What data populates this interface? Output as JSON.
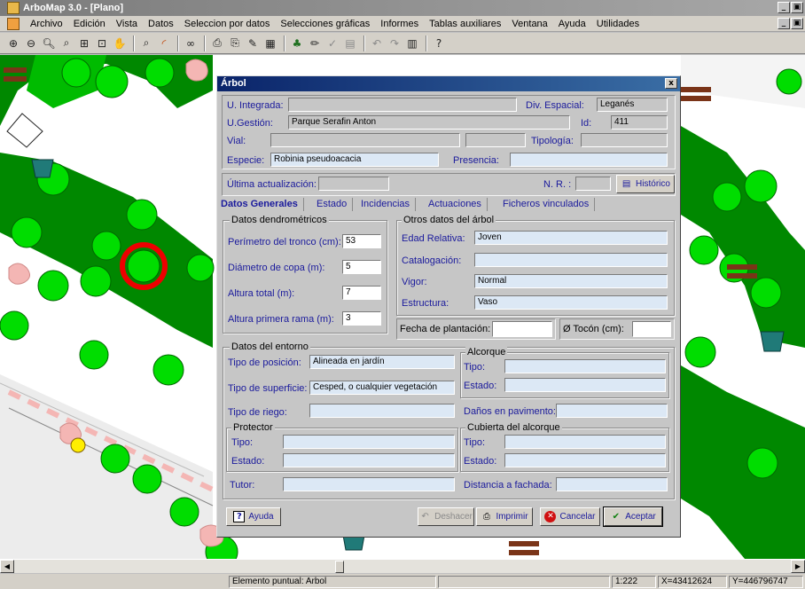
{
  "window": {
    "title": "ArboMap 3.0 - [Plano]",
    "controls": [
      "_",
      "ő",
      "x"
    ]
  },
  "menu": {
    "items": [
      "Archivo",
      "Edición",
      "Vista",
      "Datos",
      "Seleccion por datos",
      "Selecciones gráficas",
      "Informes",
      "Tablas auxiliares",
      "Ventana",
      "Ayuda",
      "Utilidades"
    ]
  },
  "toolbar": {
    "icons": [
      "zoom-in-icon",
      "zoom-out-icon",
      "zoom-previous-icon",
      "zoom-window-icon",
      "zoom-extents-icon",
      "zoom-all-icon",
      "pan-hand-icon",
      "zoom-select-icon",
      "color-rainbow-icon",
      "binoculars-icon",
      "print-icon",
      "print-preview-icon",
      "paint-icon",
      "table-icon",
      "tree-data-icon",
      "pencil-icon",
      "check-icon",
      "chart-icon",
      "undo-icon",
      "redo-icon",
      "map-icon",
      "help-icon"
    ]
  },
  "dialog": {
    "title": "Árbol",
    "close": "x",
    "u_integrada": {
      "label": "U. Integrada:",
      "value": ""
    },
    "div_espacial": {
      "label": "Div. Espacial:",
      "value": "Leganés"
    },
    "u_gestion": {
      "label": "U.Gestión:",
      "value": "Parque Serafin Anton"
    },
    "id": {
      "label": "Id:",
      "value": "411"
    },
    "vial": {
      "label": "Vial:",
      "value": ""
    },
    "tipologia": {
      "label": "Tipología:",
      "value": ""
    },
    "especie": {
      "label": "Especie:",
      "value": "Robinia pseudoacacia"
    },
    "presencia": {
      "label": "Presencia:",
      "value": ""
    },
    "ultima_actualizacion": {
      "label": "Última actualización:",
      "value": ""
    },
    "nr": {
      "label": "N. R. :",
      "value": ""
    },
    "historico_button": "Histórico",
    "tabs": [
      "Datos Generales",
      "Estado",
      "Incidencias",
      "Actuaciones",
      "Ficheros vinculados"
    ],
    "dendro": {
      "legend": "Datos dendrométricos",
      "perimetro": {
        "label": "Perímetro del tronco (cm):",
        "value": "53"
      },
      "diametro": {
        "label": "Diámetro de copa (m):",
        "value": "5"
      },
      "altura_total": {
        "label": "Altura total (m):",
        "value": "7"
      },
      "altura_rama": {
        "label": "Altura primera rama (m):",
        "value": "3"
      }
    },
    "otros": {
      "legend": "Otros datos del árbol",
      "edad": {
        "label": "Edad Relativa:",
        "value": "Joven"
      },
      "catalogacion": {
        "label": "Catalogación:",
        "value": ""
      },
      "vigor": {
        "label": "Vigor:",
        "value": "Normal"
      },
      "estructura": {
        "label": "Estructura:",
        "value": "Vaso"
      }
    },
    "fecha_plantacion": {
      "label": "Fecha de plantación:",
      "value": ""
    },
    "tocon": {
      "label": "Ø Tocón (cm):",
      "value": ""
    },
    "entorno": {
      "legend": "Datos del entorno",
      "tipo_posicion": {
        "label": "Tipo de posición:",
        "value": "Alineada en jardín"
      },
      "tipo_superficie": {
        "label": "Tipo de superficie:",
        "value": "Cesped, o cualquier vegetación"
      },
      "tipo_riego": {
        "label": "Tipo de riego:",
        "value": ""
      },
      "tutor": {
        "label": "Tutor:",
        "value": ""
      }
    },
    "alcorque": {
      "legend": "Alcorque",
      "tipo": {
        "label": "Tipo:",
        "value": ""
      },
      "estado": {
        "label": "Estado:",
        "value": ""
      },
      "danos": {
        "label": "Daños en pavimento:",
        "value": ""
      }
    },
    "protector": {
      "legend": "Protector",
      "tipo": {
        "label": "Tipo:",
        "value": ""
      },
      "estado": {
        "label": "Estado:",
        "value": ""
      }
    },
    "cubierta": {
      "legend": "Cubierta del alcorque",
      "tipo": {
        "label": "Tipo:",
        "value": ""
      },
      "estado": {
        "label": "Estado:",
        "value": ""
      },
      "distancia": {
        "label": "Distancia a fachada:",
        "value": ""
      }
    },
    "buttons": {
      "ayuda": "Ayuda",
      "deshacer": "Deshacer",
      "imprimir": "Imprimir",
      "cancelar": "Cancelar",
      "aceptar": "Aceptar"
    }
  },
  "statusbar": {
    "element": "Elemento puntual: Arbol",
    "scale": "1:222",
    "x": "X=43412624",
    "y": "Y=446796747"
  },
  "colors": {
    "park_green": "#008800",
    "tree_green": "#00dd00",
    "selection_ring": "#ee0000",
    "planter_pink": "#f4b6b4",
    "bench_brown": "#7a3418",
    "bin_teal": "#207a78"
  }
}
